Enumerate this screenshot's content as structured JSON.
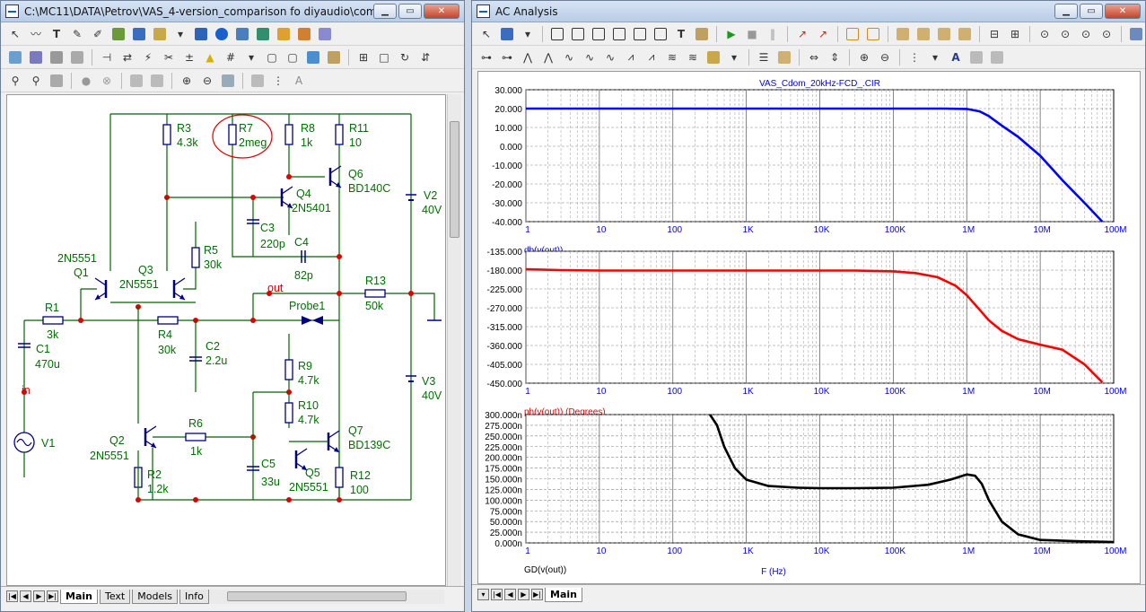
{
  "left_window": {
    "title": "C:\\MC11\\DATA\\Petrov\\VAS_4-version_comparison fo diyaudio\\compari...",
    "tabs": [
      "Main",
      "Text",
      "Models",
      "Info"
    ],
    "active_tab": "Main"
  },
  "right_window": {
    "title": "AC Analysis",
    "tabs": [
      "Main"
    ],
    "active_tab": "Main"
  },
  "window_controls": {
    "minimize": "▁",
    "restore": "▭",
    "close": "✕"
  },
  "schematic": {
    "labels": {
      "R3": "R3",
      "R3v": "4.3k",
      "R7": "R7",
      "R7v": "2meg",
      "R8": "R8",
      "R8v": "1k",
      "R11": "R11",
      "R11v": "10",
      "Q6": "Q6",
      "Q6m": "BD140C",
      "Q4": "Q4",
      "Q4m": "2N5401",
      "C3": "C3",
      "C3v": "220p",
      "C4": "C4",
      "C4v": "82p",
      "V2": "V2",
      "V2v": "40V",
      "R5": "R5",
      "R5v": "30k",
      "Q1m": "2N5551",
      "Q1": "Q1",
      "Q3": "Q3",
      "Q3m": "2N5551",
      "R13": "R13",
      "R13v": "50k",
      "out": "out",
      "R1": "R1",
      "R1v": "3k",
      "Probe1": "Probe1",
      "R4": "R4",
      "R4v": "30k",
      "C1": "C1",
      "C1v": "470u",
      "C2": "C2",
      "C2v": "2.2u",
      "R9": "R9",
      "R9v": "4.7k",
      "V3": "V3",
      "V3v": "40V",
      "in": "in",
      "R10": "R10",
      "R10v": "4.7k",
      "V1": "V1",
      "Q2": "Q2",
      "Q2m": "2N5551",
      "R6": "R6",
      "R6v": "1k",
      "Q7": "Q7",
      "Q7m": "BD139C",
      "C5": "C5",
      "C5v": "33u",
      "Q5": "Q5",
      "Q5m": "2N5551",
      "R2": "R2",
      "R2v": "1.2k",
      "R12": "R12",
      "R12v": "100"
    }
  },
  "chart_data": [
    {
      "type": "line",
      "title": "VAS_Cdom_20kHz-FCD_.CIR",
      "xlabel": "db(v(out))",
      "x_scale": "log",
      "xlim": [
        1,
        100000000
      ],
      "x_tick_labels": [
        "1",
        "10",
        "100",
        "1K",
        "10K",
        "100K",
        "1M",
        "10M",
        "100M"
      ],
      "ylim": [
        -40,
        30
      ],
      "y_tick_labels": [
        "30.000",
        "20.000",
        "10.000",
        "0.000",
        "-10.000",
        "-20.000",
        "-30.000",
        "-40.000"
      ],
      "color": "#0000ff",
      "series": [
        {
          "x": [
            1,
            10,
            100,
            1000,
            10000,
            100000,
            500000,
            1000000,
            1500000,
            2000000,
            3000000,
            5000000,
            10000000,
            20000000,
            40000000,
            70000000
          ],
          "y": [
            20,
            20,
            20,
            20,
            20,
            20,
            20,
            19.8,
            18.5,
            16,
            11,
            5,
            -5,
            -18,
            -30,
            -40
          ]
        }
      ]
    },
    {
      "type": "line",
      "xlabel": "ph(v(out)) (Degrees)",
      "x_scale": "log",
      "xlim": [
        1,
        100000000
      ],
      "x_tick_labels": [
        "1",
        "10",
        "100",
        "1K",
        "10K",
        "100K",
        "1M",
        "10M",
        "100M"
      ],
      "ylim": [
        -450,
        -135
      ],
      "y_tick_labels": [
        "-135.000",
        "-180.000",
        "-225.000",
        "-270.000",
        "-315.000",
        "-360.000",
        "-405.000",
        "-450.000"
      ],
      "color": "#ff0000",
      "series": [
        {
          "x": [
            1,
            3,
            10,
            100,
            1000,
            10000,
            30000,
            100000,
            200000,
            400000,
            700000,
            1000000,
            1500000,
            2000000,
            3000000,
            5000000,
            10000000,
            20000000,
            40000000,
            70000000
          ],
          "y": [
            -178,
            -180,
            -181,
            -181,
            -181,
            -181,
            -181,
            -183,
            -187,
            -197,
            -217,
            -240,
            -275,
            -300,
            -325,
            -345,
            -358,
            -370,
            -405,
            -448
          ]
        }
      ]
    },
    {
      "type": "line",
      "xlabel": "GD(v(out))",
      "ylabel": "F (Hz)",
      "x_scale": "log",
      "xlim": [
        1,
        100000000
      ],
      "x_tick_labels": [
        "1",
        "10",
        "100",
        "1K",
        "10K",
        "100K",
        "1M",
        "10M",
        "100M"
      ],
      "ylim": [
        0,
        300
      ],
      "y_tick_labels": [
        "300.000n",
        "275.000n",
        "250.000n",
        "225.000n",
        "200.000n",
        "175.000n",
        "150.000n",
        "125.000n",
        "100.000n",
        "75.000n",
        "50.000n",
        "25.000n",
        "0.000n"
      ],
      "color": "#000000",
      "series": [
        {
          "x": [
            320,
            400,
            500,
            700,
            1000,
            2000,
            5000,
            10000,
            30000,
            100000,
            300000,
            600000,
            1000000,
            1300000,
            1600000,
            2000000,
            3000000,
            5000000,
            10000000,
            30000000,
            100000000
          ],
          "y": [
            300,
            275,
            225,
            175,
            148,
            133,
            129,
            128,
            128,
            129,
            136,
            148,
            160,
            157,
            138,
            100,
            50,
            20,
            7,
            4,
            2
          ]
        }
      ]
    }
  ]
}
